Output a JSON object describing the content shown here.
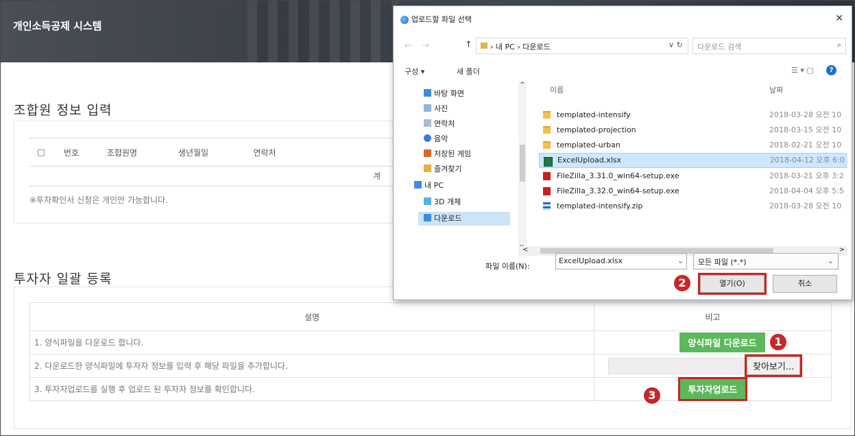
{
  "app": {
    "title": "개인소득공제 시스템"
  },
  "member_section": {
    "title": "조합원 정보 입력",
    "columns": [
      "□",
      "번호",
      "조합원명",
      "생년월일",
      "연락처"
    ],
    "total_label": "계",
    "note": "※투자확인서 신청은 개인만 가능합니다."
  },
  "bulk_section": {
    "title": "투자자 일괄 등록",
    "headers": [
      "설명",
      "비고"
    ],
    "rows": [
      {
        "desc": "1. 양식파일을 다운로드 합니다.",
        "action": "양식파일 다운로드"
      },
      {
        "desc": "2. 다운로드한 양식파일에 투자자 정보를 입력 후 해당 파일을 추가합니다.",
        "action": "찾아보기..."
      },
      {
        "desc": "3. 투자자업로드를 실행 후 업로드 된 투자자 정보를 확인합니다.",
        "action": "투자자업로드"
      }
    ]
  },
  "callouts": [
    "1",
    "2",
    "3"
  ],
  "dialog": {
    "title": "업로드할 파일 선택",
    "close": "✕",
    "nav_arrows": "← →",
    "up_arrow": "↑",
    "path": "› 내 PC › 다운로드",
    "path_tools": "∨ ↻",
    "search_placeholder": "다운로드 검색",
    "search_icon": "⌕",
    "toolbar": {
      "organize": "구성 ▾",
      "new_folder": "새 폴더",
      "view_icons": "☰ ▾   ▢",
      "help": "?"
    },
    "nav_items": [
      {
        "label": "바탕 화면",
        "icon": "desktop-folder-icon"
      },
      {
        "label": "사진",
        "icon": "pictures-folder-icon"
      },
      {
        "label": "연락처",
        "icon": "contacts-folder-icon"
      },
      {
        "label": "음악",
        "icon": "music-folder-icon"
      },
      {
        "label": "저장된 게임",
        "icon": "games-folder-icon"
      },
      {
        "label": "즐겨찾기",
        "icon": "favorites-folder-icon"
      },
      {
        "label": "내 PC",
        "icon": "pc-icon"
      },
      {
        "label": "3D 개체",
        "icon": "3d-objects-folder-icon"
      },
      {
        "label": "다운로드",
        "icon": "downloads-folder-icon",
        "selected": true
      }
    ],
    "nav_scroll_arrows": [
      "^",
      "v"
    ],
    "columns": {
      "name": "이름",
      "date": "날짜"
    },
    "files": [
      {
        "name": "templated-intensify",
        "date": "2018-03-28 오전 10",
        "type": "folder"
      },
      {
        "name": "templated-projection",
        "date": "2018-03-15 오전 10",
        "type": "folder"
      },
      {
        "name": "templated-urban",
        "date": "2018-02-21 오전 10",
        "type": "folder"
      },
      {
        "name": "ExcelUpload.xlsx",
        "date": "2018-04-12 오후 6:0",
        "type": "excel",
        "selected": true
      },
      {
        "name": "FileZilla_3.31.0_win64-setup.exe",
        "date": "2018-03-21 오후 3:2",
        "type": "filezilla"
      },
      {
        "name": "FileZilla_3.32.0_win64-setup.exe",
        "date": "2018-04-04 오후 5:5",
        "type": "filezilla"
      },
      {
        "name": "templated-intensify.zip",
        "date": "2018-03-28 오전 10",
        "type": "zip"
      }
    ],
    "hscroll_arrows": [
      "<",
      ">"
    ],
    "filename_label": "파일 이름(N):",
    "filename_value": "ExcelUpload.xlsx",
    "filetype_value": "모든 파일 (*.*)",
    "open_label": "열기(O)",
    "cancel_label": "취소"
  }
}
